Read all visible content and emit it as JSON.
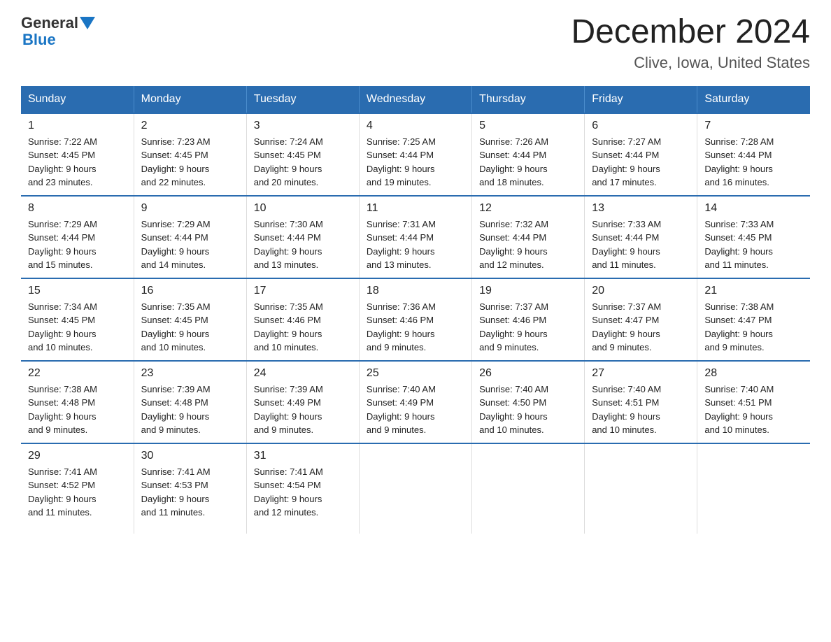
{
  "header": {
    "logo_general": "General",
    "logo_blue": "Blue",
    "title": "December 2024",
    "subtitle": "Clive, Iowa, United States"
  },
  "days_of_week": [
    "Sunday",
    "Monday",
    "Tuesday",
    "Wednesday",
    "Thursday",
    "Friday",
    "Saturday"
  ],
  "weeks": [
    [
      {
        "day": "1",
        "sunrise": "7:22 AM",
        "sunset": "4:45 PM",
        "daylight": "9 hours and 23 minutes."
      },
      {
        "day": "2",
        "sunrise": "7:23 AM",
        "sunset": "4:45 PM",
        "daylight": "9 hours and 22 minutes."
      },
      {
        "day": "3",
        "sunrise": "7:24 AM",
        "sunset": "4:45 PM",
        "daylight": "9 hours and 20 minutes."
      },
      {
        "day": "4",
        "sunrise": "7:25 AM",
        "sunset": "4:44 PM",
        "daylight": "9 hours and 19 minutes."
      },
      {
        "day": "5",
        "sunrise": "7:26 AM",
        "sunset": "4:44 PM",
        "daylight": "9 hours and 18 minutes."
      },
      {
        "day": "6",
        "sunrise": "7:27 AM",
        "sunset": "4:44 PM",
        "daylight": "9 hours and 17 minutes."
      },
      {
        "day": "7",
        "sunrise": "7:28 AM",
        "sunset": "4:44 PM",
        "daylight": "9 hours and 16 minutes."
      }
    ],
    [
      {
        "day": "8",
        "sunrise": "7:29 AM",
        "sunset": "4:44 PM",
        "daylight": "9 hours and 15 minutes."
      },
      {
        "day": "9",
        "sunrise": "7:29 AM",
        "sunset": "4:44 PM",
        "daylight": "9 hours and 14 minutes."
      },
      {
        "day": "10",
        "sunrise": "7:30 AM",
        "sunset": "4:44 PM",
        "daylight": "9 hours and 13 minutes."
      },
      {
        "day": "11",
        "sunrise": "7:31 AM",
        "sunset": "4:44 PM",
        "daylight": "9 hours and 13 minutes."
      },
      {
        "day": "12",
        "sunrise": "7:32 AM",
        "sunset": "4:44 PM",
        "daylight": "9 hours and 12 minutes."
      },
      {
        "day": "13",
        "sunrise": "7:33 AM",
        "sunset": "4:44 PM",
        "daylight": "9 hours and 11 minutes."
      },
      {
        "day": "14",
        "sunrise": "7:33 AM",
        "sunset": "4:45 PM",
        "daylight": "9 hours and 11 minutes."
      }
    ],
    [
      {
        "day": "15",
        "sunrise": "7:34 AM",
        "sunset": "4:45 PM",
        "daylight": "9 hours and 10 minutes."
      },
      {
        "day": "16",
        "sunrise": "7:35 AM",
        "sunset": "4:45 PM",
        "daylight": "9 hours and 10 minutes."
      },
      {
        "day": "17",
        "sunrise": "7:35 AM",
        "sunset": "4:46 PM",
        "daylight": "9 hours and 10 minutes."
      },
      {
        "day": "18",
        "sunrise": "7:36 AM",
        "sunset": "4:46 PM",
        "daylight": "9 hours and 9 minutes."
      },
      {
        "day": "19",
        "sunrise": "7:37 AM",
        "sunset": "4:46 PM",
        "daylight": "9 hours and 9 minutes."
      },
      {
        "day": "20",
        "sunrise": "7:37 AM",
        "sunset": "4:47 PM",
        "daylight": "9 hours and 9 minutes."
      },
      {
        "day": "21",
        "sunrise": "7:38 AM",
        "sunset": "4:47 PM",
        "daylight": "9 hours and 9 minutes."
      }
    ],
    [
      {
        "day": "22",
        "sunrise": "7:38 AM",
        "sunset": "4:48 PM",
        "daylight": "9 hours and 9 minutes."
      },
      {
        "day": "23",
        "sunrise": "7:39 AM",
        "sunset": "4:48 PM",
        "daylight": "9 hours and 9 minutes."
      },
      {
        "day": "24",
        "sunrise": "7:39 AM",
        "sunset": "4:49 PM",
        "daylight": "9 hours and 9 minutes."
      },
      {
        "day": "25",
        "sunrise": "7:40 AM",
        "sunset": "4:49 PM",
        "daylight": "9 hours and 9 minutes."
      },
      {
        "day": "26",
        "sunrise": "7:40 AM",
        "sunset": "4:50 PM",
        "daylight": "9 hours and 10 minutes."
      },
      {
        "day": "27",
        "sunrise": "7:40 AM",
        "sunset": "4:51 PM",
        "daylight": "9 hours and 10 minutes."
      },
      {
        "day": "28",
        "sunrise": "7:40 AM",
        "sunset": "4:51 PM",
        "daylight": "9 hours and 10 minutes."
      }
    ],
    [
      {
        "day": "29",
        "sunrise": "7:41 AM",
        "sunset": "4:52 PM",
        "daylight": "9 hours and 11 minutes."
      },
      {
        "day": "30",
        "sunrise": "7:41 AM",
        "sunset": "4:53 PM",
        "daylight": "9 hours and 11 minutes."
      },
      {
        "day": "31",
        "sunrise": "7:41 AM",
        "sunset": "4:54 PM",
        "daylight": "9 hours and 12 minutes."
      },
      null,
      null,
      null,
      null
    ]
  ],
  "labels": {
    "sunrise": "Sunrise:",
    "sunset": "Sunset:",
    "daylight": "Daylight:"
  }
}
